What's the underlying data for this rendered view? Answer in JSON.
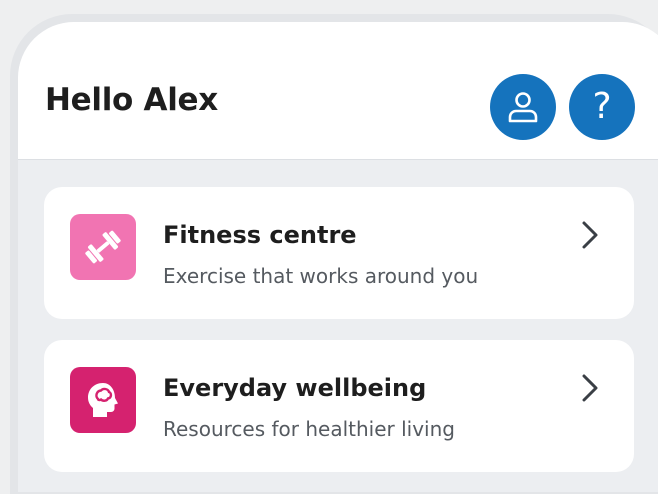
{
  "header": {
    "greeting": "Hello Alex",
    "profile_icon": "user-icon",
    "help_label": "?"
  },
  "cards": [
    {
      "title": "Fitness centre",
      "subtitle": "Exercise that works around you",
      "icon": "dumbbell-icon",
      "tile_color": "#f174b2"
    },
    {
      "title": "Everyday wellbeing",
      "subtitle": "Resources for healthier living",
      "icon": "head-brain-icon",
      "tile_color": "#d5226f"
    }
  ],
  "colors": {
    "accent": "#1573bd",
    "background": "#eceef1",
    "text": "#1e1e1e"
  }
}
